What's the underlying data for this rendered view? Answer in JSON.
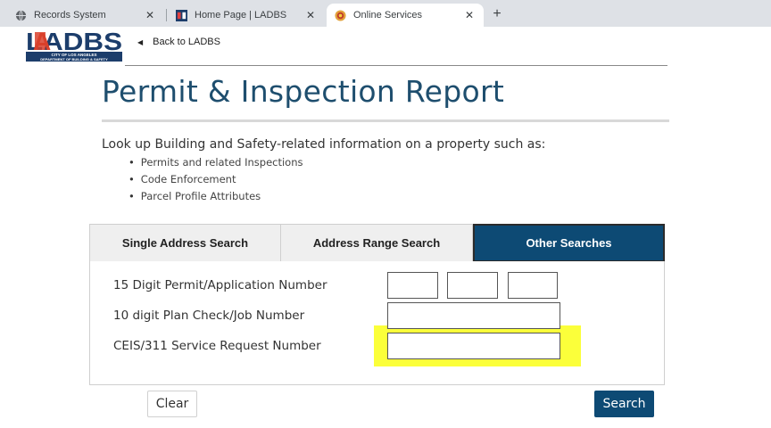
{
  "browser": {
    "tabs": [
      {
        "title": "Records System",
        "icon": "globe-icon",
        "active": false
      },
      {
        "title": "Home Page | LADBS",
        "icon": "ladbs-favicon",
        "active": false
      },
      {
        "title": "Online Services",
        "icon": "ladbs-seal-favicon",
        "active": true
      }
    ],
    "close_glyph": "✕",
    "new_tab_glyph": "+"
  },
  "header": {
    "logo_text": "LADBS",
    "logo_subtext_1": "CITY OF LOS ANGELES",
    "logo_subtext_2": "DEPARTMENT OF BUILDING & SAFETY",
    "back_link": "Back to LADBS"
  },
  "page": {
    "title": "Permit & Inspection Report",
    "intro": "Look up Building and Safety-related information on a property such as:",
    "bullets": [
      "Permits and related Inspections",
      "Code Enforcement",
      "Parcel Profile Attributes"
    ]
  },
  "search_tabs": [
    {
      "label": "Single Address Search",
      "active": false
    },
    {
      "label": "Address Range Search",
      "active": false
    },
    {
      "label": "Other Searches",
      "active": true
    }
  ],
  "form": {
    "permit_label": "15 Digit Permit/Application Number",
    "plan_check_label": "10 digit Plan Check/Job Number",
    "ceis_label": "CEIS/311 Service Request Number",
    "permit_part1": "",
    "permit_part2": "",
    "permit_part3": "",
    "plan_check_value": "",
    "ceis_value": ""
  },
  "buttons": {
    "clear": "Clear",
    "search": "Search"
  },
  "colors": {
    "brand_navy": "#0d4a74",
    "title_blue": "#1e4e6e",
    "highlight_yellow": "#fbff3a"
  }
}
